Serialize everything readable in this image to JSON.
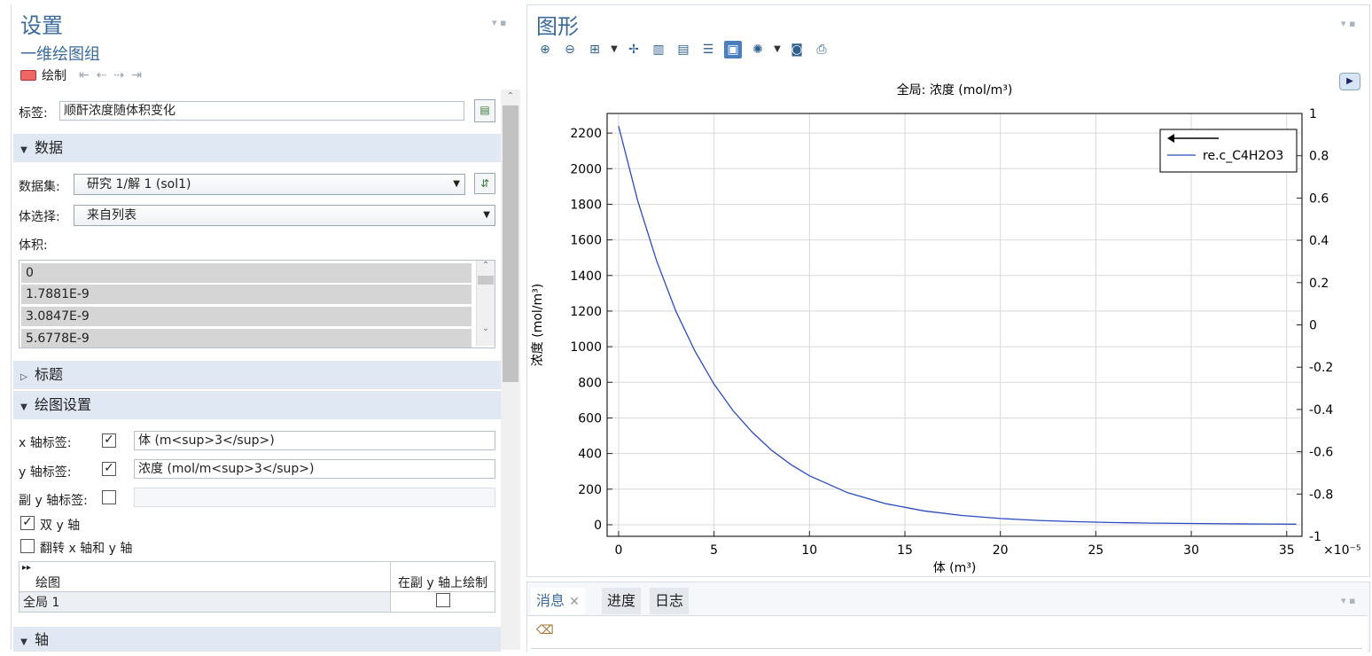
{
  "settings": {
    "title": "设置",
    "subtitle": "一维绘图组",
    "plot_label": "绘制",
    "label_caption": "标签:",
    "label_value": "顺酐浓度随体积变化",
    "sections": {
      "data": "数据",
      "title": "标题",
      "plot_settings": "绘图设置",
      "axis": "轴"
    },
    "dataset_caption": "数据集:",
    "dataset_value": "研究 1/解 1 (sol1)",
    "volume_select_caption": "体选择:",
    "volume_select_value": "来自列表",
    "volume_caption": "体积:",
    "volume_list": [
      "0",
      "1.7881E-9",
      "3.0847E-9",
      "5.6778E-9"
    ],
    "x_label_caption": "x 轴标签:",
    "x_label_checked": true,
    "x_label_value": "体 (m<sup>3</sup>)",
    "y_label_caption": "y 轴标签:",
    "y_label_checked": true,
    "y_label_value": "浓度 (mol/m<sup>3</sup>)",
    "y2_label_caption": "副 y 轴标签:",
    "y2_label_checked": false,
    "dual_y_label": "双 y 轴",
    "dual_y_checked": true,
    "flip_label": "翻转 x 轴和 y 轴",
    "flip_checked": false,
    "plot_table": {
      "col1": "绘图",
      "col2": "在副 y 轴上绘制",
      "rows": [
        {
          "name": "全局 1",
          "secondary": false
        }
      ]
    }
  },
  "graphics": {
    "title": "图形",
    "toolbar_icons": [
      "zoom-in-icon",
      "zoom-out-icon",
      "zoom-box-icon",
      "dropdown-icon",
      "zoom-extents-icon",
      "grid-icon",
      "grid-icon",
      "grid-icon",
      "frame-icon",
      "scene-light-icon",
      "dropdown-icon",
      "camera-icon",
      "print-icon"
    ]
  },
  "chart_data": {
    "type": "line",
    "title": "全局: 浓度 (mol/m³)",
    "xlabel": "体 (m³)",
    "ylabel": "浓度 (mol/m³)",
    "x_multiplier": "×10⁻⁵",
    "xlim": [
      -0.6,
      35.8
    ],
    "ylim": [
      -65,
      2310
    ],
    "y2lim": [
      -1,
      1
    ],
    "xticks": [
      0,
      5,
      10,
      15,
      20,
      25,
      30,
      35
    ],
    "yticks": [
      0,
      200,
      400,
      600,
      800,
      1000,
      1200,
      1400,
      1600,
      1800,
      2000,
      2200
    ],
    "y2ticks": [
      -1,
      -0.8,
      -0.6,
      -0.4,
      -0.2,
      0,
      0.2,
      0.4,
      0.6,
      0.8,
      1
    ],
    "grid": true,
    "legend_position": "top-right",
    "series": [
      {
        "name": "re.c_C4H2O3",
        "color": "#2a4bbf",
        "x": [
          0,
          1,
          2,
          3,
          4,
          5,
          6,
          7,
          8,
          9,
          10,
          12,
          14,
          16,
          18,
          20,
          22,
          24,
          26,
          28,
          30,
          32,
          34,
          35.5
        ],
        "y": [
          2240,
          1820,
          1480,
          1200,
          975,
          790,
          640,
          520,
          420,
          340,
          275,
          180,
          118,
          78,
          52,
          35,
          24,
          17,
          12,
          9,
          7,
          5,
          4,
          3
        ]
      }
    ]
  },
  "messages": {
    "tabs": [
      "消息",
      "进度",
      "日志"
    ]
  }
}
